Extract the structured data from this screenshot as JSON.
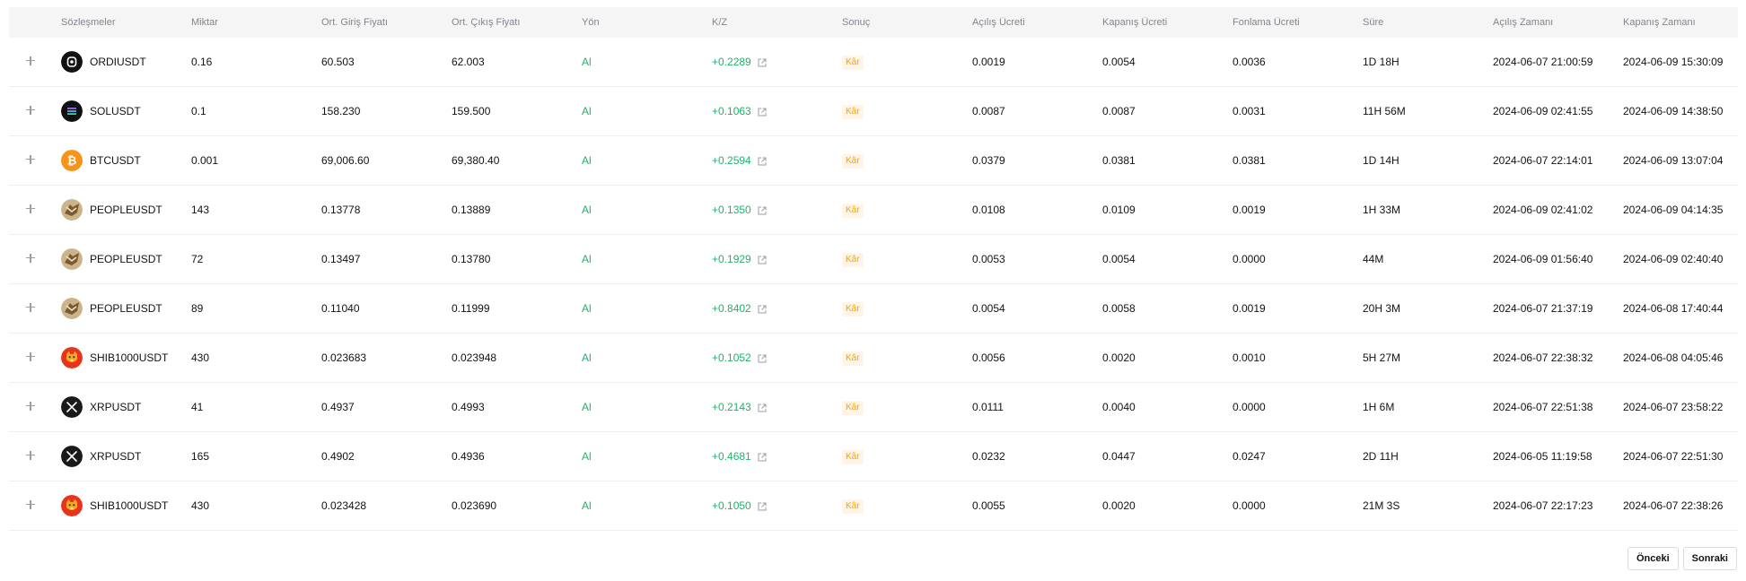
{
  "columns": {
    "contract": "Sözleşmeler",
    "qty": "Miktar",
    "entry": "Ort. Giriş Fiyatı",
    "exit": "Ort. Çıkış Fiyatı",
    "side": "Yön",
    "pnl": "K/Z",
    "result": "Sonuç",
    "open_fee": "Açılış Ücreti",
    "close_fee": "Kapanış Ücreti",
    "funding_fee": "Fonlama Ücreti",
    "duration": "Süre",
    "open_time": "Açılış Zamanı",
    "close_time": "Kapanış Zamanı"
  },
  "rows": [
    {
      "icon": "ordi-coin-icon",
      "contract": "ORDIUSDT",
      "qty": "0.16",
      "entry": "60.503",
      "exit": "62.003",
      "side": "Al",
      "pnl": "+0.2289",
      "result": "Kâr",
      "open_fee": "0.0019",
      "close_fee": "0.0054",
      "funding_fee": "0.0036",
      "duration": "1D 18H",
      "open_time": "2024-06-07 21:00:59",
      "close_time": "2024-06-09 15:30:09"
    },
    {
      "icon": "sol-coin-icon",
      "contract": "SOLUSDT",
      "qty": "0.1",
      "entry": "158.230",
      "exit": "159.500",
      "side": "Al",
      "pnl": "+0.1063",
      "result": "Kâr",
      "open_fee": "0.0087",
      "close_fee": "0.0087",
      "funding_fee": "0.0031",
      "duration": "11H 56M",
      "open_time": "2024-06-09 02:41:55",
      "close_time": "2024-06-09 14:38:50"
    },
    {
      "icon": "btc-coin-icon",
      "contract": "BTCUSDT",
      "qty": "0.001",
      "entry": "69,006.60",
      "exit": "69,380.40",
      "side": "Al",
      "pnl": "+0.2594",
      "result": "Kâr",
      "open_fee": "0.0379",
      "close_fee": "0.0381",
      "funding_fee": "0.0381",
      "duration": "1D 14H",
      "open_time": "2024-06-07 22:14:01",
      "close_time": "2024-06-09 13:07:04"
    },
    {
      "icon": "people-coin-icon",
      "contract": "PEOPLEUSDT",
      "qty": "143",
      "entry": "0.13778",
      "exit": "0.13889",
      "side": "Al",
      "pnl": "+0.1350",
      "result": "Kâr",
      "open_fee": "0.0108",
      "close_fee": "0.0109",
      "funding_fee": "0.0019",
      "duration": "1H 33M",
      "open_time": "2024-06-09 02:41:02",
      "close_time": "2024-06-09 04:14:35"
    },
    {
      "icon": "people-coin-icon",
      "contract": "PEOPLEUSDT",
      "qty": "72",
      "entry": "0.13497",
      "exit": "0.13780",
      "side": "Al",
      "pnl": "+0.1929",
      "result": "Kâr",
      "open_fee": "0.0053",
      "close_fee": "0.0054",
      "funding_fee": "0.0000",
      "duration": "44M",
      "open_time": "2024-06-09 01:56:40",
      "close_time": "2024-06-09 02:40:40"
    },
    {
      "icon": "people-coin-icon",
      "contract": "PEOPLEUSDT",
      "qty": "89",
      "entry": "0.11040",
      "exit": "0.11999",
      "side": "Al",
      "pnl": "+0.8402",
      "result": "Kâr",
      "open_fee": "0.0054",
      "close_fee": "0.0058",
      "funding_fee": "0.0019",
      "duration": "20H 3M",
      "open_time": "2024-06-07 21:37:19",
      "close_time": "2024-06-08 17:40:44"
    },
    {
      "icon": "shib-coin-icon",
      "contract": "SHIB1000USDT",
      "qty": "430",
      "entry": "0.023683",
      "exit": "0.023948",
      "side": "Al",
      "pnl": "+0.1052",
      "result": "Kâr",
      "open_fee": "0.0056",
      "close_fee": "0.0020",
      "funding_fee": "0.0010",
      "duration": "5H 27M",
      "open_time": "2024-06-07 22:38:32",
      "close_time": "2024-06-08 04:05:46"
    },
    {
      "icon": "xrp-coin-icon",
      "contract": "XRPUSDT",
      "qty": "41",
      "entry": "0.4937",
      "exit": "0.4993",
      "side": "Al",
      "pnl": "+0.2143",
      "result": "Kâr",
      "open_fee": "0.0111",
      "close_fee": "0.0040",
      "funding_fee": "0.0000",
      "duration": "1H 6M",
      "open_time": "2024-06-07 22:51:38",
      "close_time": "2024-06-07 23:58:22"
    },
    {
      "icon": "xrp-coin-icon",
      "contract": "XRPUSDT",
      "qty": "165",
      "entry": "0.4902",
      "exit": "0.4936",
      "side": "Al",
      "pnl": "+0.4681",
      "result": "Kâr",
      "open_fee": "0.0232",
      "close_fee": "0.0447",
      "funding_fee": "0.0247",
      "duration": "2D 11H",
      "open_time": "2024-06-05 11:19:58",
      "close_time": "2024-06-07 22:51:30"
    },
    {
      "icon": "shib-coin-icon",
      "contract": "SHIB1000USDT",
      "qty": "430",
      "entry": "0.023428",
      "exit": "0.023690",
      "side": "Al",
      "pnl": "+0.1050",
      "result": "Kâr",
      "open_fee": "0.0055",
      "close_fee": "0.0020",
      "funding_fee": "0.0000",
      "duration": "21M 3S",
      "open_time": "2024-06-07 22:17:23",
      "close_time": "2024-06-07 22:38:26"
    }
  ],
  "pagination": {
    "prev_label": "Önceki",
    "next_label": "Sonraki"
  },
  "colors": {
    "positive": "#20b26c",
    "badge_text": "#f7a600",
    "badge_bg": "#fff4e5",
    "header_bg": "#f5f5f5",
    "header_text": "#81858c"
  }
}
